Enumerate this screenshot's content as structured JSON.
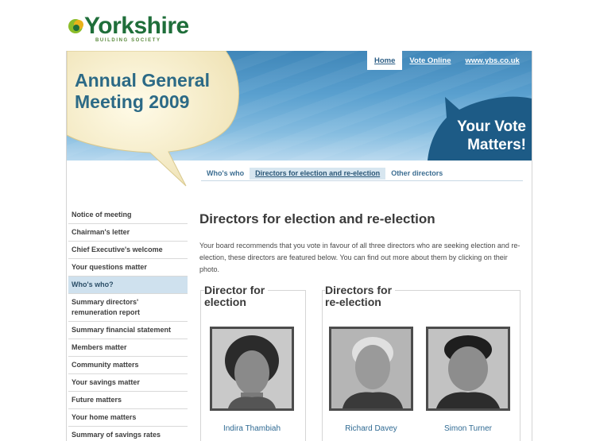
{
  "logo": {
    "name": "Yorkshire",
    "sub": "BUILDING SOCIETY"
  },
  "topnav": [
    {
      "label": "Home",
      "active": true
    },
    {
      "label": "Vote Online",
      "active": false
    },
    {
      "label": "www.ybs.co.uk",
      "active": false
    }
  ],
  "header": {
    "agm_line1": "Annual General",
    "agm_line2": "Meeting 2009",
    "vote_line1": "Your Vote",
    "vote_line2": "Matters!"
  },
  "subtabs": [
    {
      "label": "Who's who",
      "active": false
    },
    {
      "label": "Directors for election and re-election",
      "active": true
    },
    {
      "label": "Other directors",
      "active": false
    }
  ],
  "sidebar": {
    "items": [
      {
        "label": "Notice of meeting",
        "active": false
      },
      {
        "label": "Chairman's letter",
        "active": false
      },
      {
        "label": "Chief Executive's welcome",
        "active": false
      },
      {
        "label": "Your questions matter",
        "active": false
      },
      {
        "label": "Who's who?",
        "active": true
      },
      {
        "label": "Summary directors' remuneration report",
        "active": false
      },
      {
        "label": "Summary financial statement",
        "active": false
      },
      {
        "label": "Members matter",
        "active": false
      },
      {
        "label": "Community matters",
        "active": false
      },
      {
        "label": "Your savings matter",
        "active": false
      },
      {
        "label": "Future matters",
        "active": false
      },
      {
        "label": "Your home matters",
        "active": false
      },
      {
        "label": "Summary of savings rates",
        "active": false
      }
    ]
  },
  "main": {
    "title": "Directors for election and re-election",
    "intro": "Your board recommends that you vote in favour of all three directors who are seeking election and re-election, these directors are featured below. You can find out more about them by clicking on their photo.",
    "election_heading_line1": "Director for",
    "election_heading_line2": "election",
    "reelection_heading_line1": "Directors for",
    "reelection_heading_line2": "re-election",
    "directors": [
      {
        "name": "Indira Thambiah"
      },
      {
        "name": "Richard Davey"
      },
      {
        "name": "Simon Turner"
      }
    ]
  },
  "colors": {
    "banner_blue": "#3f86b8",
    "logo_green": "#1f6e3a",
    "link_blue": "#2f6a93",
    "active_tab_bg": "#d7e6f0"
  }
}
